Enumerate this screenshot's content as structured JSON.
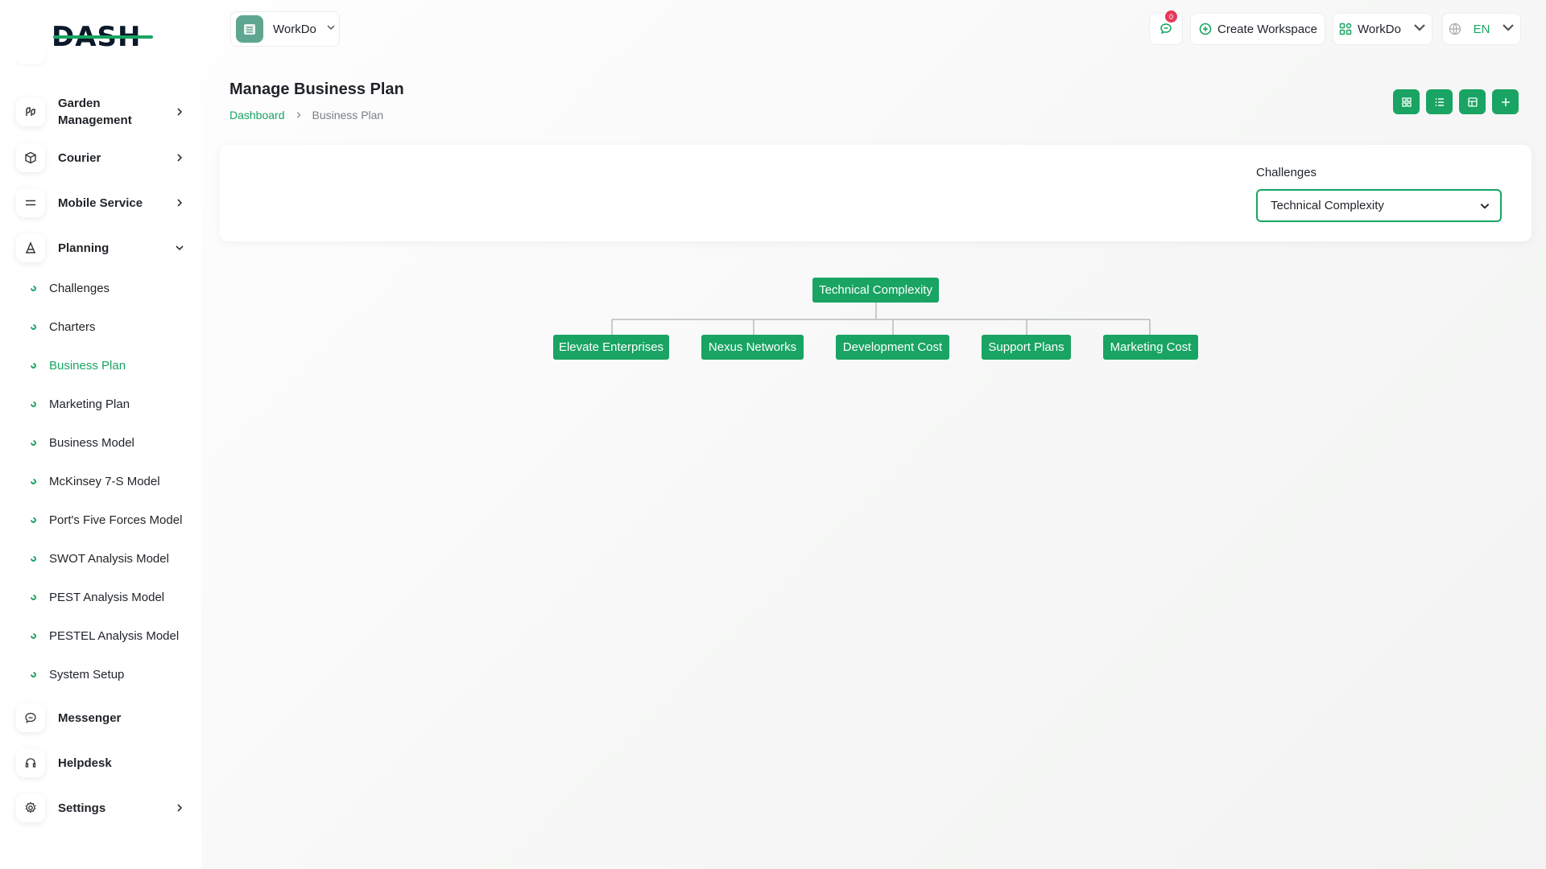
{
  "sidebar": {
    "logo": "DASH",
    "items": [
      {
        "label": "Garden Management",
        "icon": "plant-icon"
      },
      {
        "label": "Courier",
        "icon": "box-icon"
      },
      {
        "label": "Mobile Service",
        "icon": "menu-lines-icon"
      },
      {
        "label": "Planning",
        "icon": "planning-icon"
      },
      {
        "label": "Messenger",
        "icon": "chat-icon"
      },
      {
        "label": "Helpdesk",
        "icon": "headset-icon"
      },
      {
        "label": "Settings",
        "icon": "gear-icon"
      }
    ],
    "planning_sub": [
      "Challenges",
      "Charters",
      "Business Plan",
      "Marketing Plan",
      "Business Model",
      "McKinsey 7-S Model",
      "Port's Five Forces Model",
      "SWOT Analysis Model",
      "PEST Analysis Model",
      "PESTEL Analysis Model",
      "System Setup"
    ],
    "active_sub": "Business Plan"
  },
  "topbar": {
    "workspace_name": "WorkDo",
    "notification_count": "0",
    "create_workspace": "Create Workspace",
    "user_workspace": "WorkDo",
    "language": "EN"
  },
  "page": {
    "title": "Manage Business Plan",
    "breadcrumb": {
      "home": "Dashboard",
      "current": "Business Plan"
    }
  },
  "filter": {
    "label": "Challenges",
    "selected": "Technical Complexity"
  },
  "tree": {
    "root": "Technical Complexity",
    "children": [
      "Elevate Enterprises",
      "Nexus Networks",
      "Development Cost",
      "Support Plans",
      "Marketing Cost"
    ]
  },
  "colors": {
    "accent": "#19a463",
    "badge": "#e8395a"
  }
}
